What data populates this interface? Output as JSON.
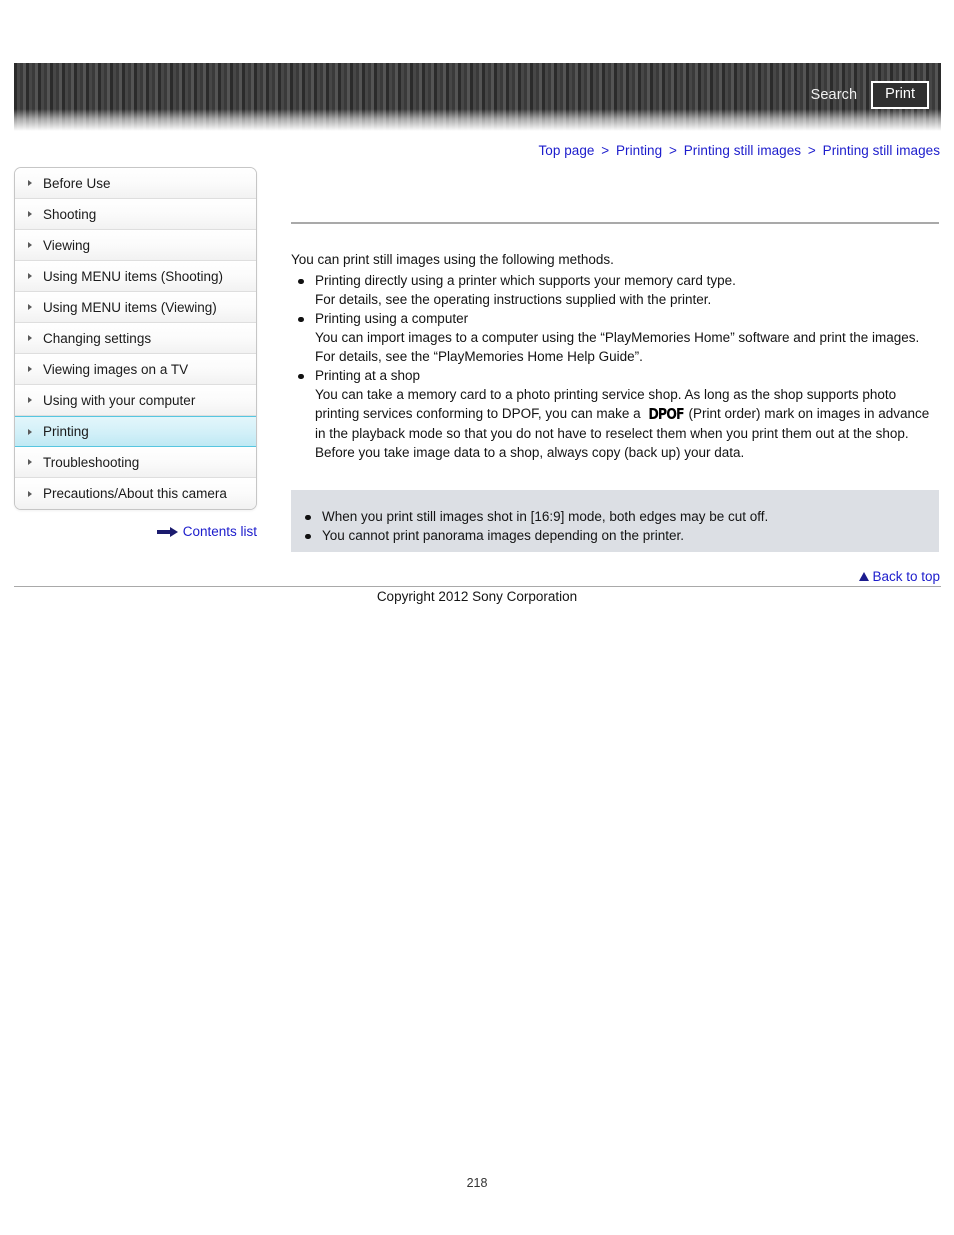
{
  "header": {
    "search_label": "Search",
    "print_label": "Print"
  },
  "breadcrumb": {
    "separator": ">",
    "items": [
      {
        "label": "Top page"
      },
      {
        "label": "Printing"
      },
      {
        "label": "Printing still images"
      },
      {
        "label": "Printing still images"
      }
    ]
  },
  "sidebar": {
    "items": [
      {
        "label": "Before Use",
        "selected": false
      },
      {
        "label": "Shooting",
        "selected": false
      },
      {
        "label": "Viewing",
        "selected": false
      },
      {
        "label": "Using MENU items (Shooting)",
        "selected": false
      },
      {
        "label": "Using MENU items (Viewing)",
        "selected": false
      },
      {
        "label": "Changing settings",
        "selected": false
      },
      {
        "label": "Viewing images on a TV",
        "selected": false
      },
      {
        "label": "Using with your computer",
        "selected": false
      },
      {
        "label": "Printing",
        "selected": true
      },
      {
        "label": "Troubleshooting",
        "selected": false
      },
      {
        "label": "Precautions/About this camera",
        "selected": false
      }
    ],
    "contents_list_label": "Contents list"
  },
  "main": {
    "intro": "You can print still images using the following methods.",
    "methods": [
      {
        "bullet": "Printing directly using a printer which supports your memory card type.",
        "sub_lines": [
          "For details, see the operating instructions supplied with the printer."
        ]
      },
      {
        "bullet": "Printing using a computer",
        "sub_lines": [
          "You can import images to a computer using the “PlayMemories Home” software and print the images.",
          "For details, see the “PlayMemories Home Help Guide”."
        ]
      },
      {
        "bullet": "Printing at a shop",
        "sub_lines": [],
        "rich_sub": {
          "before": "You can take a memory card to a photo printing service shop. As long as the shop supports photo printing services conforming to DPOF, you can make a ",
          "logo": "DPOF",
          "after": "(Print order) mark on images in advance in the playback mode so that you do not have to reselect them when you print them out at the shop. Before you take image data to a shop, always copy (back up) your data."
        }
      }
    ]
  },
  "notes": {
    "items": [
      "When you print still images shot in [16:9] mode, both edges may be cut off.",
      "You cannot print panorama images depending on the printer."
    ]
  },
  "footer": {
    "back_to_top_label": "Back to top",
    "copyright": "Copyright 2012 Sony Corporation",
    "page_number": "218"
  }
}
